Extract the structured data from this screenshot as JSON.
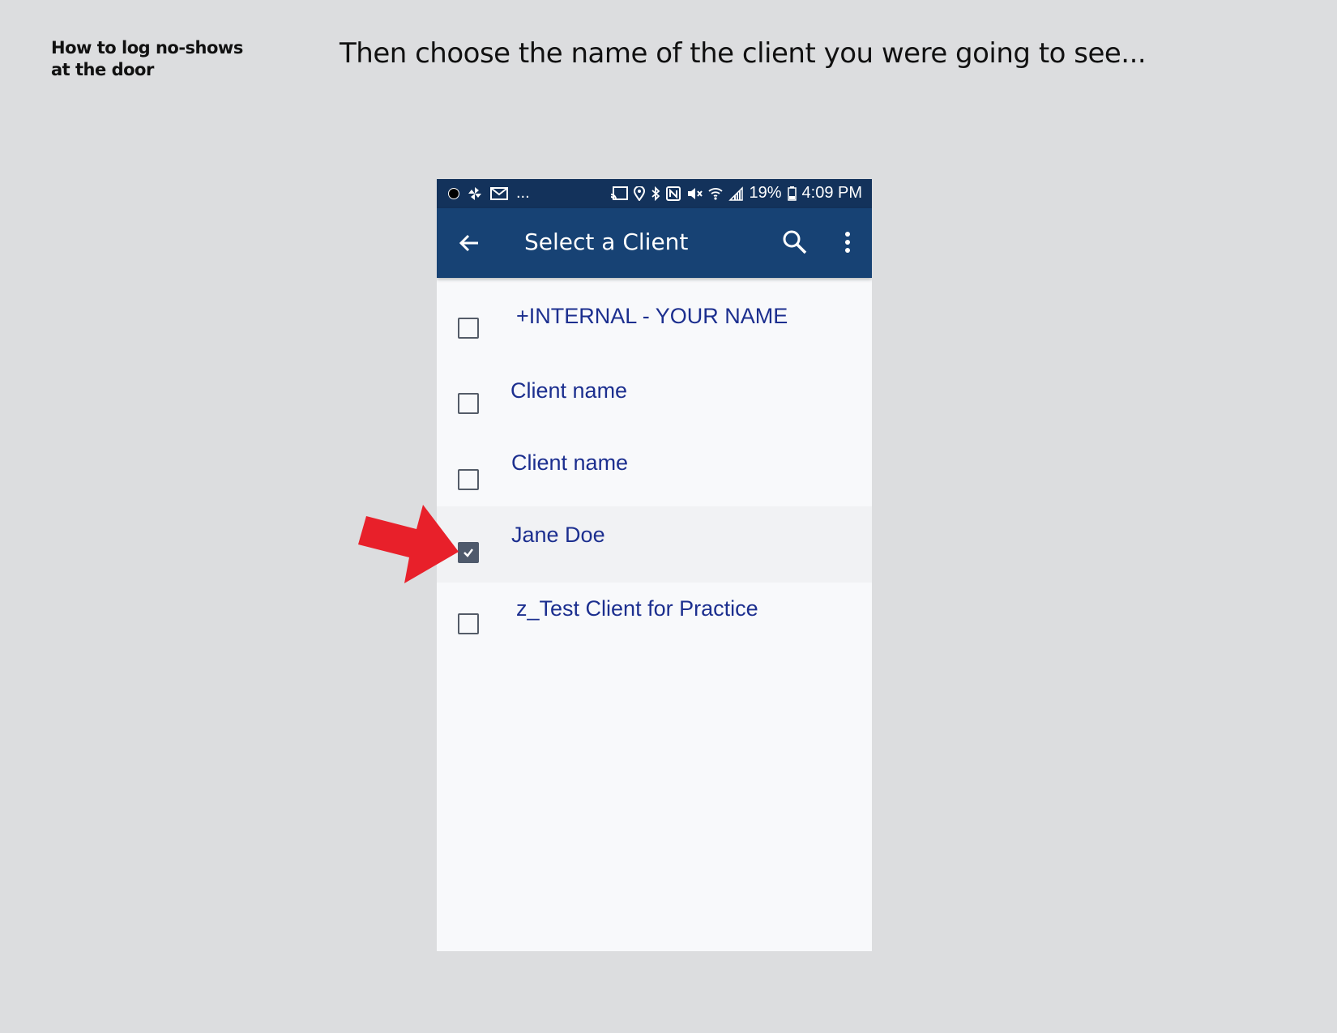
{
  "slide": {
    "section_title_line1": "How to log no-shows",
    "section_title_line2": "at the door",
    "instruction": "Then choose the name of the client you were going to see..."
  },
  "status_bar": {
    "overflow": "...",
    "battery": "19%",
    "time": "4:09 PM",
    "background_color": "#13325b"
  },
  "app_bar": {
    "title": "Select a Client",
    "background_color": "#174274",
    "icons": [
      "back-arrow-icon",
      "search-icon",
      "more-vert-icon"
    ]
  },
  "clients": [
    {
      "name": "+INTERNAL - YOUR NAME",
      "checked": false
    },
    {
      "name": "Client name",
      "checked": false
    },
    {
      "name": "Client name",
      "checked": false
    },
    {
      "name": "Jane Doe",
      "checked": true
    },
    {
      "name": "z_Test Client for Practice",
      "checked": false
    }
  ],
  "annotation": {
    "arrow_color": "#e8202a"
  }
}
